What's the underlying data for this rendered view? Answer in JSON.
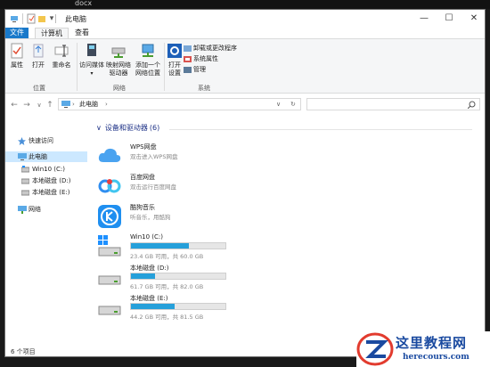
{
  "document": {
    "file_name": "docx"
  },
  "window": {
    "title": "此电脑",
    "min_glyph": "—",
    "max_glyph": "☐",
    "close_glyph": "✕"
  },
  "tabs": {
    "file": "文件",
    "computer": "计算机",
    "view": "查看"
  },
  "ribbon": {
    "properties": "属性",
    "open": "打开",
    "rename": "重命名",
    "access_media": "访问媒体",
    "map_drive_l1": "映射网络",
    "map_drive_l2": "驱动器",
    "add_location_l1": "添加一个",
    "add_location_l2": "网络位置",
    "open_settings_l1": "打开",
    "open_settings_l2": "设置",
    "uninstall": "卸载或更改程序",
    "system_properties": "系统属性",
    "manage": "管理",
    "group_location": "位置",
    "group_network": "网络",
    "group_system": "系统"
  },
  "address": {
    "back": "←",
    "forward": "→",
    "up_list": "∨",
    "up": "↑",
    "path": "此电脑",
    "sep": "›",
    "dropdown": "∨",
    "refresh": "↻",
    "search_icon": "search-icon"
  },
  "sidebar": {
    "quick_access": "快速访问",
    "this_pc": "此电脑",
    "c_drive": "Win10 (C:)",
    "d_drive": "本地磁盘 (D:)",
    "e_drive": "本地磁盘 (E:)",
    "network": "网络"
  },
  "content": {
    "group_title": "设备和驱动器",
    "group_count": "(6)",
    "items": [
      {
        "name": "WPS网盘",
        "sub": "双击进入WPS网盘"
      },
      {
        "name": "百度网盘",
        "sub": "双击运行百度网盘"
      },
      {
        "name": "酷狗音乐",
        "sub": "听音乐，用酷狗"
      }
    ],
    "drives": [
      {
        "name": "Win10 (C:)",
        "free_text": "23.4 GB 可用，共 60.0 GB",
        "used_fraction": 0.61
      },
      {
        "name": "本地磁盘 (D:)",
        "free_text": "61.7 GB 可用，共 82.0 GB",
        "used_fraction": 0.25
      },
      {
        "name": "本地磁盘 (E:)",
        "free_text": "44.2 GB 可用，共 81.5 GB",
        "used_fraction": 0.46
      }
    ]
  },
  "status": {
    "item_count": "6 个项目"
  },
  "watermark": {
    "title": "这里教程网",
    "url": "herecours.com"
  },
  "colors": {
    "accent": "#1979ca",
    "bar_fill": "#26a0da",
    "selection": "#cce8ff",
    "group_header": "#1e3287"
  }
}
